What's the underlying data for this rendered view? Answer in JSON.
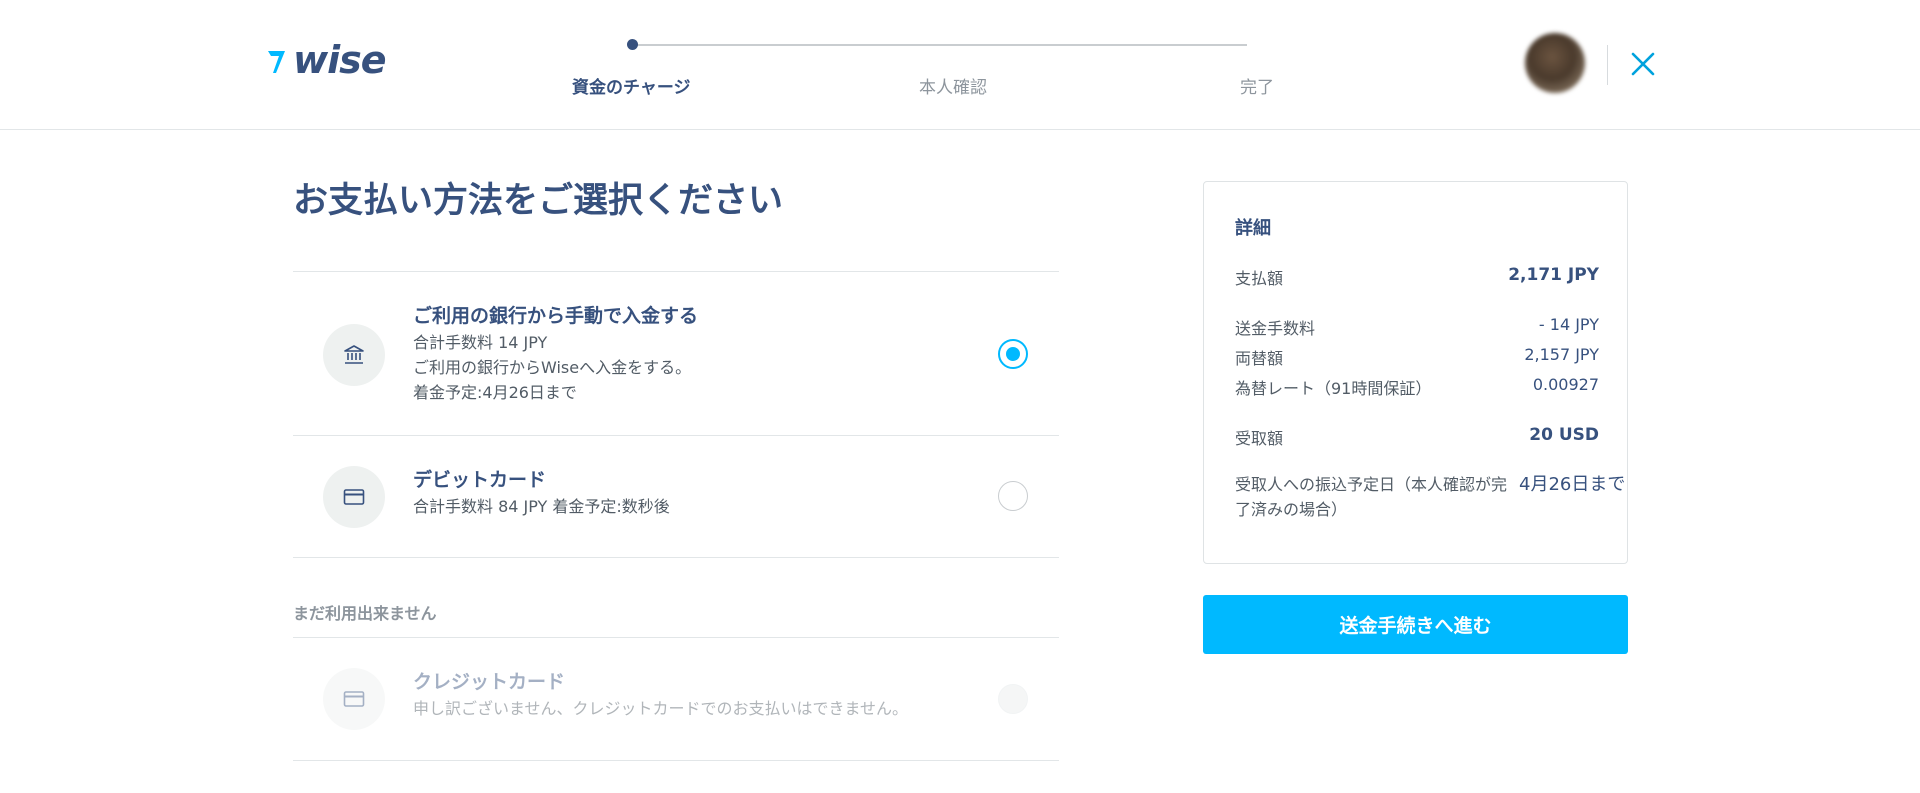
{
  "header": {
    "logo_text": "wise",
    "steps": [
      {
        "label": "資金のチャージ",
        "active": true
      },
      {
        "label": "本人確認",
        "active": false
      },
      {
        "label": "完了",
        "active": false
      }
    ],
    "accent_color": "#00b9ff",
    "brand_color": "#37517e"
  },
  "main": {
    "title": "お支払い方法をご選択ください",
    "payment_options": [
      {
        "icon": "bank-icon",
        "title": "ご利用の銀行から手動で入金する",
        "lines": [
          "合計手数料 14 JPY",
          "ご利用の銀行からWiseへ入金をする。",
          "着金予定:4月26日まで"
        ],
        "selected": true
      },
      {
        "icon": "card-icon",
        "title": "デビットカード",
        "lines": [
          "合計手数料 84 JPY 着金予定:数秒後"
        ],
        "selected": false
      }
    ],
    "unavailable_label": "まだ利用出来ません",
    "unavailable_options": [
      {
        "icon": "card-icon",
        "title": "クレジットカード",
        "lines": [
          "申し訳ございません、クレジットカードでのお支払いはできません。"
        ],
        "selected": false
      }
    ]
  },
  "summary": {
    "title": "詳細",
    "pay_amount_label": "支払額",
    "pay_amount_value": "2,171 JPY",
    "fee_label": "送金手数料",
    "fee_value": "- 14 JPY",
    "converted_label": "両替額",
    "converted_value": "2,157 JPY",
    "rate_label": "為替レート（91時間保証）",
    "rate_value": "0.00927",
    "receive_label": "受取額",
    "receive_value": "20 USD",
    "eta_label": "受取人への振込予定日（本人確認が完了済みの場合）",
    "eta_value": "4月26日まで"
  },
  "cta_label": "送金手続きへ進む"
}
